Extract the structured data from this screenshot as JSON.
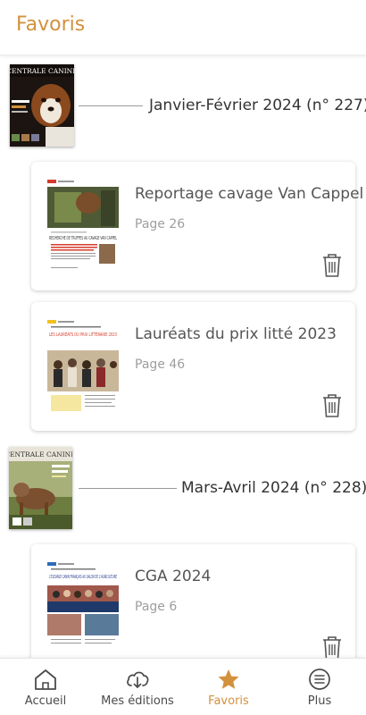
{
  "header": {
    "title": "Favoris"
  },
  "issues": [
    {
      "title": "Janvier-Février 2024 (n° 227)",
      "cover_masthead": "CENTRALE CANINE",
      "favorites": [
        {
          "title": "Reportage cavage Van Cappel",
          "page": "Page 26",
          "thumb_headline": "RECHERCHE DE TRUFFES AU CAVAGE VAN CAPPEL"
        },
        {
          "title": "Lauréats du prix litté 2023",
          "page": "Page 46",
          "thumb_headline": "LES LAURÉATS DU PRIX LITTÉRAIRE 2023"
        }
      ]
    },
    {
      "title": "Mars-Avril 2024 (n° 228)",
      "cover_masthead": "CENTRALE CANINE",
      "favorites": [
        {
          "title": "CGA 2024",
          "page": "Page 6",
          "thumb_headline": "L'ÉLEVAGE CANIN FRANÇAIS AU SALON DE L'AGRICULTURE"
        }
      ]
    }
  ],
  "tabs": [
    {
      "label": "Accueil",
      "icon": "home-icon"
    },
    {
      "label": "Mes éditions",
      "icon": "cloud-download-icon"
    },
    {
      "label": "Favoris",
      "icon": "star-icon",
      "active": true
    },
    {
      "label": "Plus",
      "icon": "menu-icon"
    }
  ],
  "colors": {
    "accent": "#d3913d",
    "text": "#333333",
    "muted": "#9e9e9e",
    "icon": "#4a4a4a"
  }
}
